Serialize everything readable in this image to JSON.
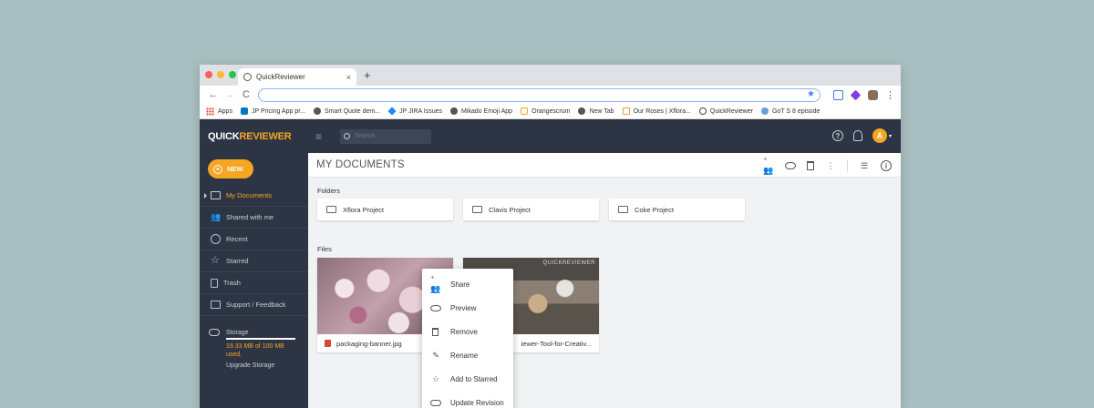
{
  "browser": {
    "tab_title": "QuickReviewer",
    "tab_close": "×",
    "new_tab": "+",
    "nav": {
      "back": "←",
      "forward": "→",
      "reload": "C"
    },
    "address_value": "",
    "bookmark_star": "★",
    "menu": "⋮",
    "bookmarks": [
      {
        "label": "Apps",
        "icon": "apps-grid-icon"
      },
      {
        "label": "JP Pricing App pr...",
        "icon": "trello-icon"
      },
      {
        "label": "Smart Quote dem...",
        "icon": "globe-icon"
      },
      {
        "label": "JP JIRA Issues",
        "icon": "jira-icon"
      },
      {
        "label": "Mikado Emoji App",
        "icon": "globe-icon"
      },
      {
        "label": "Orangescrum",
        "icon": "orangescrum-icon"
      },
      {
        "label": "New Tab",
        "icon": "globe-icon"
      },
      {
        "label": "Our Roses | Xflora...",
        "icon": "roses-icon"
      },
      {
        "label": "QuickReviewer",
        "icon": "quickreviewer-icon"
      },
      {
        "label": "GoT S 8 episode",
        "icon": "globe-icon"
      }
    ]
  },
  "app": {
    "logo_part1": "QUICK",
    "logo_part2": "REVIEWER",
    "menu_icon": "≡",
    "search_placeholder": "Search",
    "help_icon": "?",
    "user_initial": "A",
    "user_caret": "▾",
    "accent_color": "#f5a623",
    "sidebar_color": "#2d3544"
  },
  "sidebar": {
    "new_label": "NEW",
    "new_plus": "+",
    "items": [
      {
        "label": "My Documents",
        "icon": "folder-icon",
        "active": true
      },
      {
        "label": "Shared with me",
        "icon": "people-icon",
        "active": false
      },
      {
        "label": "Recent",
        "icon": "clock-icon",
        "active": false
      },
      {
        "label": "Starred",
        "icon": "star-icon",
        "active": false
      },
      {
        "label": "Trash",
        "icon": "trash-icon",
        "active": false
      },
      {
        "label": "Support / Feedback",
        "icon": "mail-icon",
        "active": false
      }
    ],
    "storage": {
      "label": "Storage",
      "used": "19.33 MB of 100 MB used.",
      "upgrade": "Upgrade Storage"
    }
  },
  "main": {
    "title": "MY DOCUMENTS",
    "folders_label": "Folders",
    "files_label": "Files",
    "folders": [
      "Xflora Project",
      "Clavis Project",
      "Coke Project"
    ],
    "files": [
      {
        "name": "packaging-banner.jpg"
      },
      {
        "name": "iewer-Tool-for-Creativ...",
        "watermark": "QUICKREVIEWER"
      }
    ]
  },
  "context_menu": {
    "items": [
      {
        "label": "Share",
        "icon": "share-people-icon"
      },
      {
        "label": "Preview",
        "icon": "eye-icon"
      },
      {
        "label": "Remove",
        "icon": "trash-icon"
      },
      {
        "label": "Rename",
        "icon": "pencil-icon"
      },
      {
        "label": "Add to Starred",
        "icon": "star-icon"
      },
      {
        "label": "Update Revision",
        "icon": "cloud-upload-icon"
      }
    ]
  }
}
